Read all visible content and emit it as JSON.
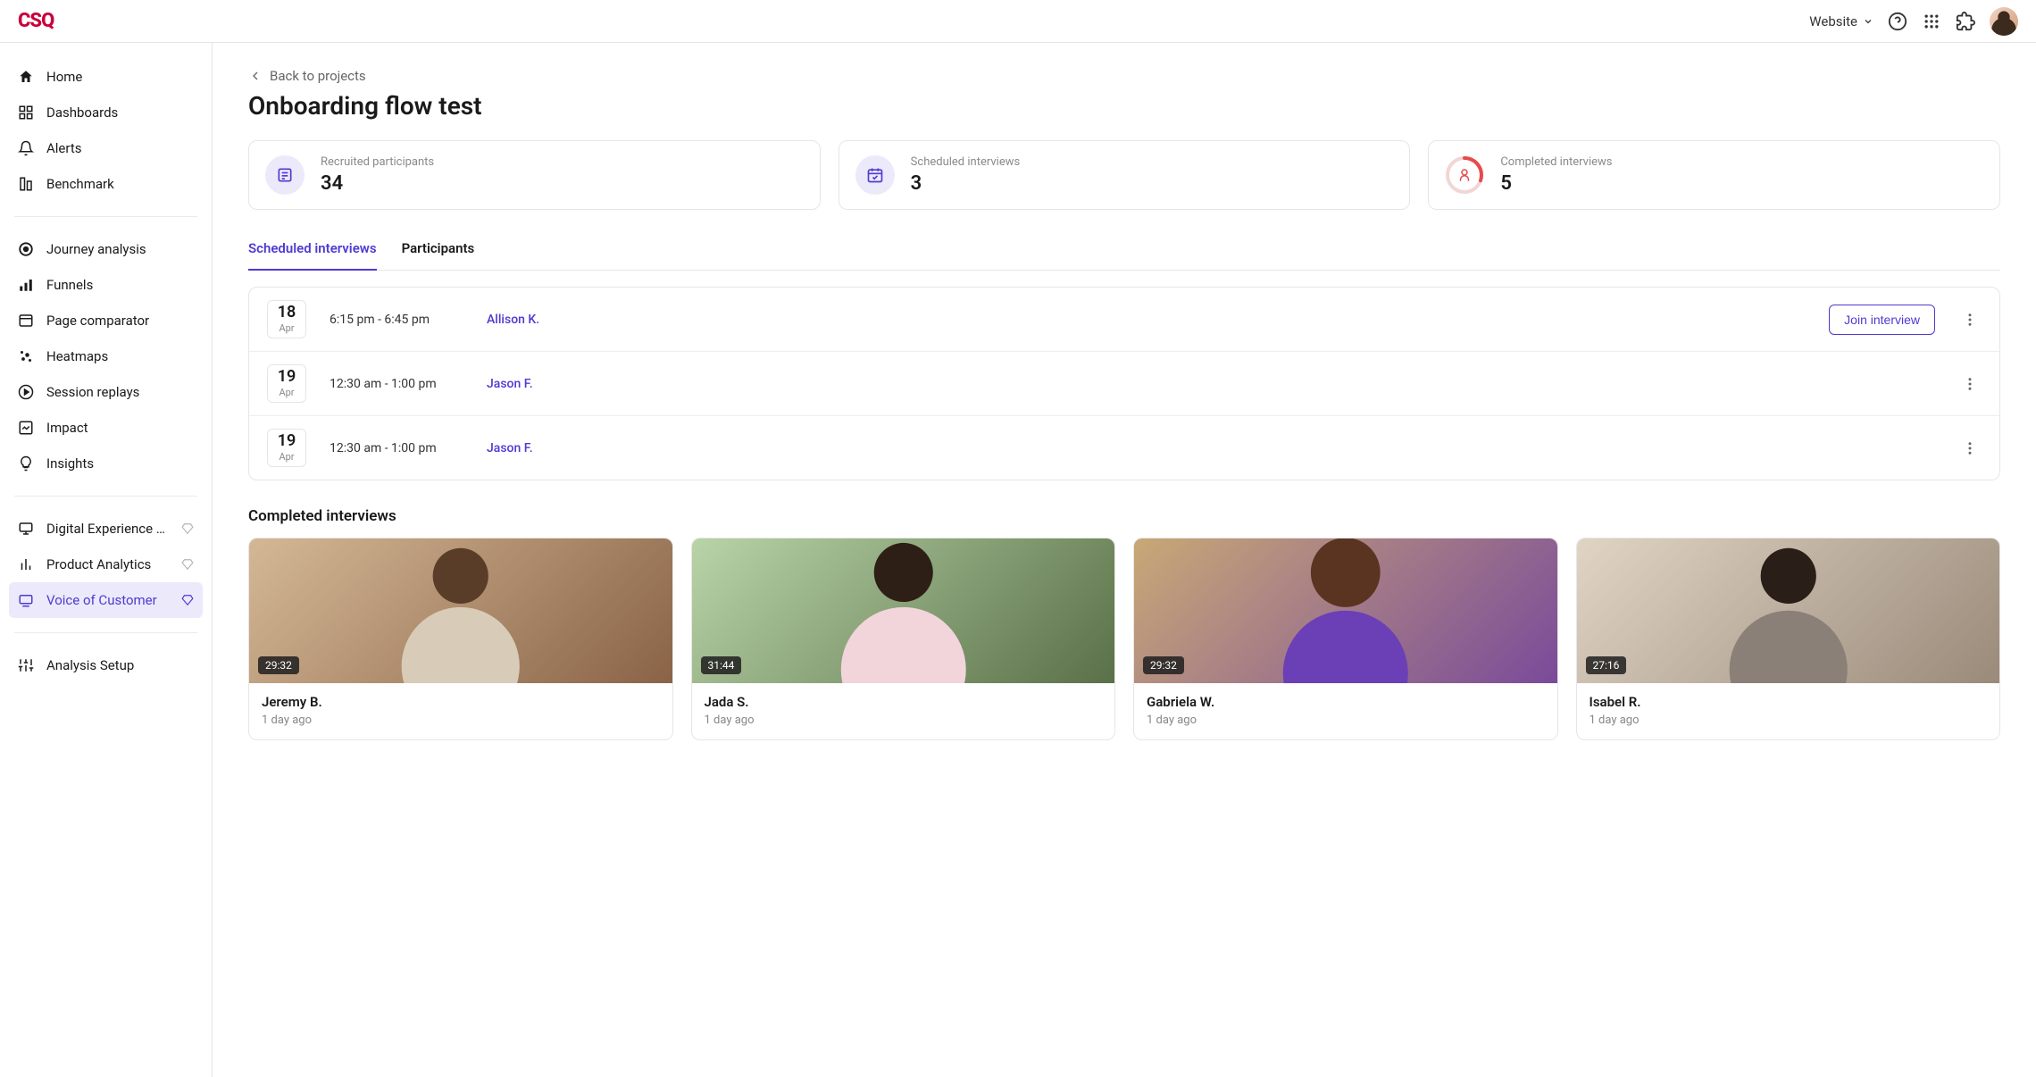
{
  "logo": "CSQ",
  "header": {
    "website_label": "Website"
  },
  "sidebar": {
    "group1": [
      {
        "label": "Home"
      },
      {
        "label": "Dashboards"
      },
      {
        "label": "Alerts"
      },
      {
        "label": "Benchmark"
      }
    ],
    "group2": [
      {
        "label": "Journey analysis"
      },
      {
        "label": "Funnels"
      },
      {
        "label": "Page comparator"
      },
      {
        "label": "Heatmaps"
      },
      {
        "label": "Session replays"
      },
      {
        "label": "Impact"
      },
      {
        "label": "Insights"
      }
    ],
    "group3": [
      {
        "label": "Digital Experience Monitor..."
      },
      {
        "label": "Product Analytics"
      },
      {
        "label": "Voice of Customer"
      }
    ],
    "group4": [
      {
        "label": "Analysis Setup"
      }
    ]
  },
  "page": {
    "back_label": "Back to projects",
    "title": "Onboarding flow test"
  },
  "stats": [
    {
      "label": "Recruited participants",
      "value": "34"
    },
    {
      "label": "Scheduled interviews",
      "value": "3"
    },
    {
      "label": "Completed interviews",
      "value": "5"
    }
  ],
  "tabs": {
    "scheduled": "Scheduled interviews",
    "participants": "Participants"
  },
  "interviews": [
    {
      "day": "18",
      "mon": "Apr",
      "time": "6:15 pm - 6:45 pm",
      "name": "Allison K.",
      "can_join": true
    },
    {
      "day": "19",
      "mon": "Apr",
      "time": "12:30 am - 1:00 pm",
      "name": "Jason F.",
      "can_join": false
    },
    {
      "day": "19",
      "mon": "Apr",
      "time": "12:30 am - 1:00 pm",
      "name": "Jason F.",
      "can_join": false
    }
  ],
  "join_label": "Join interview",
  "completed_title": "Completed interviews",
  "completed": [
    {
      "name": "Jeremy B.",
      "meta": "1 day ago",
      "dur": "29:32"
    },
    {
      "name": "Jada S.",
      "meta": "1 day ago",
      "dur": "31:44"
    },
    {
      "name": "Gabriela W.",
      "meta": "1 day ago",
      "dur": "29:32"
    },
    {
      "name": "Isabel R.",
      "meta": "1 day ago",
      "dur": "27:16"
    }
  ]
}
